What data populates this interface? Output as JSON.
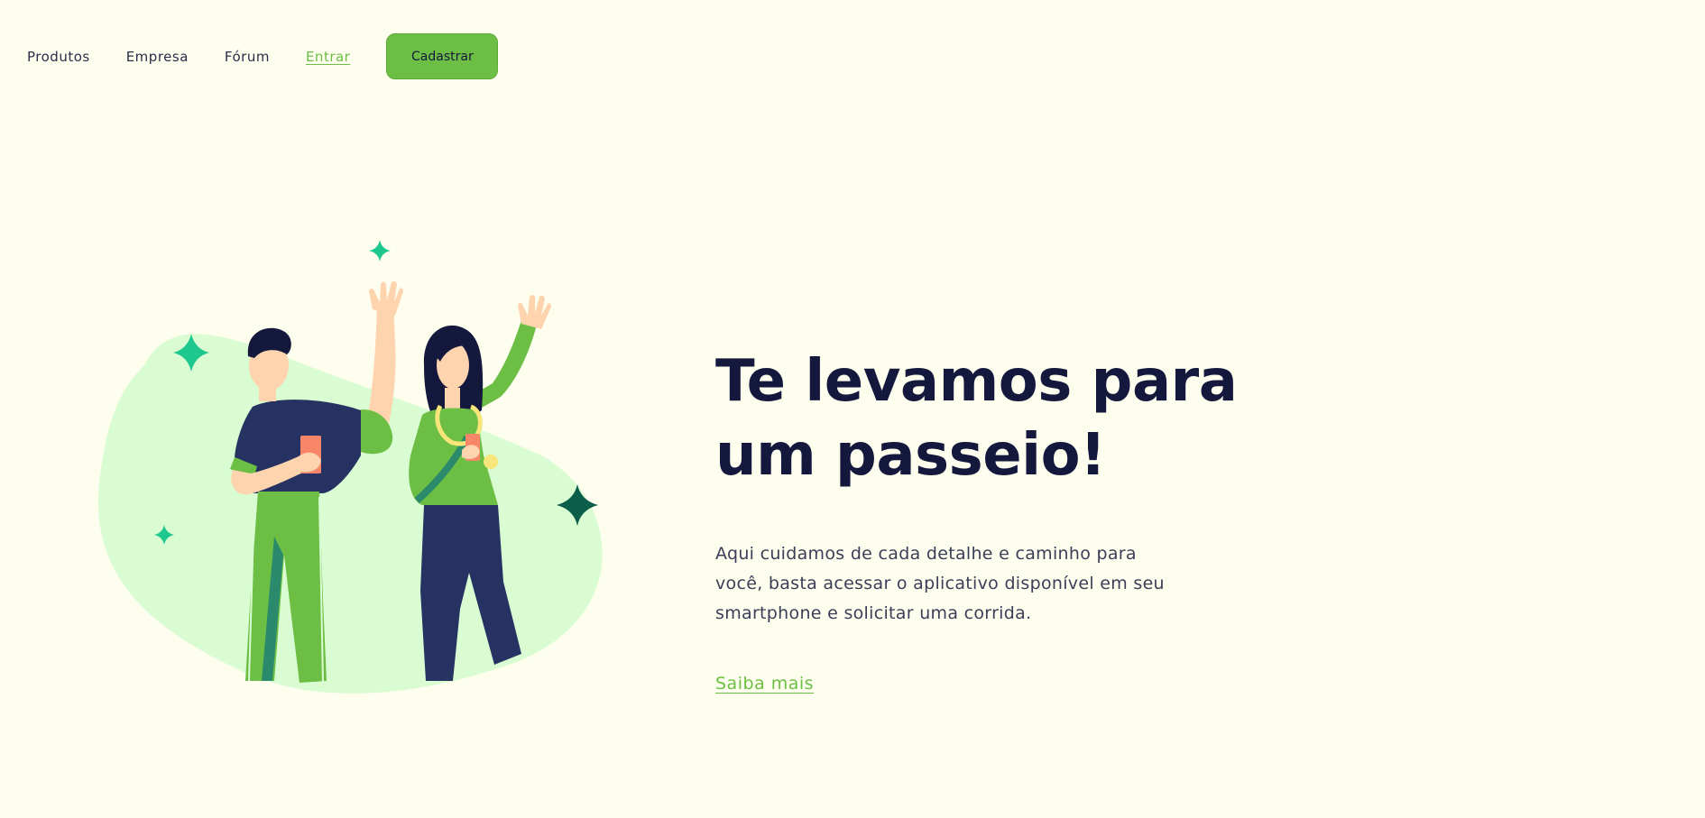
{
  "nav": {
    "items": [
      {
        "label": "Produtos"
      },
      {
        "label": "Empresa"
      },
      {
        "label": "Fórum"
      },
      {
        "label": "Entrar"
      }
    ],
    "signup_label": "Cadastrar"
  },
  "hero": {
    "title": "Te levamos para um passeio!",
    "description": "Aqui cuidamos de cada detalhe e caminho para você, basta acessar o aplicativo disponível em seu smartphone e solicitar uma corrida.",
    "cta_label": "Saiba mais",
    "illustration": "two-people-waving-illustration"
  },
  "colors": {
    "background": "#FEFEEE",
    "primary": "#6CBF44",
    "heading": "#14183D",
    "text": "#3A3E57",
    "blob": "#D9FCD2",
    "sparkle": "#1DC78D",
    "sparkle_dark": "#0B5E4A"
  }
}
